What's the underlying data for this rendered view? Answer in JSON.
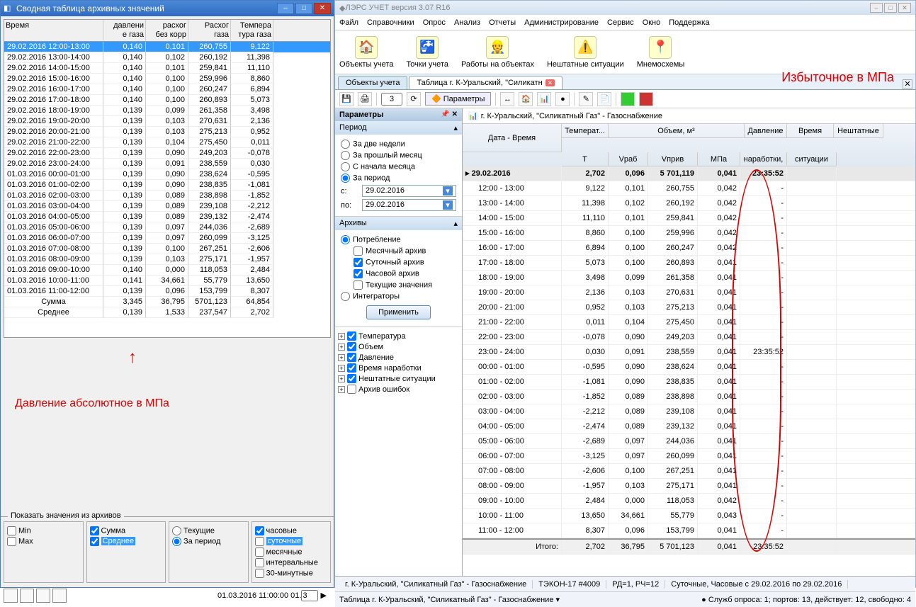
{
  "left": {
    "title": "Сводная таблица архивных значений",
    "headers": [
      "Время",
      "давлени\nе газа",
      "расхог\nбез корр",
      "Расхог\nгаза",
      "Темпера\nтура газа"
    ],
    "rows": [
      [
        "29.02.2016 12:00-13:00",
        "0,140",
        "0,101",
        "260,755",
        "9,122"
      ],
      [
        "29.02.2016 13:00-14:00",
        "0,140",
        "0,102",
        "260,192",
        "11,398"
      ],
      [
        "29.02.2016 14:00-15:00",
        "0,140",
        "0,101",
        "259,841",
        "11,110"
      ],
      [
        "29.02.2016 15:00-16:00",
        "0,140",
        "0,100",
        "259,996",
        "8,860"
      ],
      [
        "29.02.2016 16:00-17:00",
        "0,140",
        "0,100",
        "260,247",
        "6,894"
      ],
      [
        "29.02.2016 17:00-18:00",
        "0,140",
        "0,100",
        "260,893",
        "5,073"
      ],
      [
        "29.02.2016 18:00-19:00",
        "0,139",
        "0,099",
        "261,358",
        "3,498"
      ],
      [
        "29.02.2016 19:00-20:00",
        "0,139",
        "0,103",
        "270,631",
        "2,136"
      ],
      [
        "29.02.2016 20:00-21:00",
        "0,139",
        "0,103",
        "275,213",
        "0,952"
      ],
      [
        "29.02.2016 21:00-22:00",
        "0,139",
        "0,104",
        "275,450",
        "0,011"
      ],
      [
        "29.02.2016 22:00-23:00",
        "0,139",
        "0,090",
        "249,203",
        "-0,078"
      ],
      [
        "29.02.2016 23:00-24:00",
        "0,139",
        "0,091",
        "238,559",
        "0,030"
      ],
      [
        "01.03.2016 00:00-01:00",
        "0,139",
        "0,090",
        "238,624",
        "-0,595"
      ],
      [
        "01.03.2016 01:00-02:00",
        "0,139",
        "0,090",
        "238,835",
        "-1,081"
      ],
      [
        "01.03.2016 02:00-03:00",
        "0,139",
        "0,089",
        "238,898",
        "-1,852"
      ],
      [
        "01.03.2016 03:00-04:00",
        "0,139",
        "0,089",
        "239,108",
        "-2,212"
      ],
      [
        "01.03.2016 04:00-05:00",
        "0,139",
        "0,089",
        "239,132",
        "-2,474"
      ],
      [
        "01.03.2016 05:00-06:00",
        "0,139",
        "0,097",
        "244,036",
        "-2,689"
      ],
      [
        "01.03.2016 06:00-07:00",
        "0,139",
        "0,097",
        "260,099",
        "-3,125"
      ],
      [
        "01.03.2016 07:00-08:00",
        "0,139",
        "0,100",
        "267,251",
        "-2,606"
      ],
      [
        "01.03.2016 08:00-09:00",
        "0,139",
        "0,103",
        "275,171",
        "-1,957"
      ],
      [
        "01.03.2016 09:00-10:00",
        "0,140",
        "0,000",
        "118,053",
        "2,484"
      ],
      [
        "01.03.2016 10:00-11:00",
        "0,141",
        "34,661",
        "55,779",
        "13,650"
      ],
      [
        "01.03.2016 11:00-12:00",
        "0,139",
        "0,096",
        "153,799",
        "8,307"
      ]
    ],
    "sum": [
      "Сумма",
      "3,345",
      "36,795",
      "5701,123",
      "64,854"
    ],
    "avg": [
      "Среднее",
      "0,139",
      "1,533",
      "237,547",
      "2,702"
    ],
    "annot": "Давление абсолютное в МПа",
    "bottom_title": "Показать значения из архивов",
    "opts1": {
      "min": "Min",
      "max": "Max",
      "sum": "Сумма",
      "avg": "Среднее"
    },
    "opts2": {
      "cur": "Текущие",
      "per": "За период"
    },
    "opts3": {
      "h": "часовые",
      "d": "суточные",
      "m": "месячные",
      "i": "интервальные",
      "t": "30-минутные"
    },
    "status": "01.03.2016 11:00:00 01.",
    "status_n": "3"
  },
  "right": {
    "title": "ЛЭРС УЧЕТ версия 3.07 R16",
    "menu": [
      "Файл",
      "Справочники",
      "Опрос",
      "Анализ",
      "Отчеты",
      "Администрирование",
      "Сервис",
      "Окно",
      "Поддержка"
    ],
    "toolbar": [
      "Объекты учета",
      "Точки учета",
      "Работы на объектах",
      "Нештатные ситуации",
      "Мнемосхемы"
    ],
    "tabs": {
      "t1": "Объекты учета",
      "t2": "Таблица г. К-Уральский, \"Силикатн"
    },
    "page_input": "3",
    "params_btn": "Параметры",
    "side": {
      "title": "Параметры",
      "g_period": "Период",
      "p1": "За две недели",
      "p2": "За прошлый месяц",
      "p3": "С начала месяца",
      "p4": "За период",
      "from_lbl": "с:",
      "to_lbl": "по:",
      "date": "29.02.2016",
      "g_arch": "Архивы",
      "a1": "Потребление",
      "a2": "Месячный архив",
      "a3": "Суточный архив",
      "a4": "Часовой архив",
      "a5": "Текущие значения",
      "a6": "Интеграторы",
      "apply": "Применить",
      "tree": [
        "Температура",
        "Объем",
        "Давление",
        "Время наработки",
        "Нештатные ситуации",
        "Архив ошибок"
      ]
    },
    "crumb": "г. К-Уральский, \"Силикатный Газ\" - Газоснабжение",
    "annot": "Избыточное в МПа",
    "headers_top": {
      "dt": "Дата - Время",
      "temp": "Температ...",
      "vol": "Объем, м³",
      "davl": "Давление",
      "vrem": "Время",
      "nesh": "Нештатные"
    },
    "headers_bot": {
      "t": "T",
      "vr": "Vраб",
      "vp": "Vприв",
      "mpa": "МПа",
      "nar": "наработки,",
      "sit": "ситуации"
    },
    "group_date": "29.02.2016",
    "group_vals": [
      "2,702",
      "0,096",
      "5 701,119",
      "0,041",
      "23:35:52"
    ],
    "rows": [
      [
        "12:00 - 13:00",
        "9,122",
        "0,101",
        "260,755",
        "0,042",
        "-",
        ""
      ],
      [
        "13:00 - 14:00",
        "11,398",
        "0,102",
        "260,192",
        "0,042",
        "-",
        ""
      ],
      [
        "14:00 - 15:00",
        "11,110",
        "0,101",
        "259,841",
        "0,042",
        "-",
        ""
      ],
      [
        "15:00 - 16:00",
        "8,860",
        "0,100",
        "259,996",
        "0,042",
        "-",
        ""
      ],
      [
        "16:00 - 17:00",
        "6,894",
        "0,100",
        "260,247",
        "0,042",
        "-",
        ""
      ],
      [
        "17:00 - 18:00",
        "5,073",
        "0,100",
        "260,893",
        "0,041",
        "-",
        ""
      ],
      [
        "18:00 - 19:00",
        "3,498",
        "0,099",
        "261,358",
        "0,041",
        "-",
        ""
      ],
      [
        "19:00 - 20:00",
        "2,136",
        "0,103",
        "270,631",
        "0,041",
        "-",
        ""
      ],
      [
        "20:00 - 21:00",
        "0,952",
        "0,103",
        "275,213",
        "0,041",
        "-",
        ""
      ],
      [
        "21:00 - 22:00",
        "0,011",
        "0,104",
        "275,450",
        "0,041",
        "-",
        ""
      ],
      [
        "22:00 - 23:00",
        "-0,078",
        "0,090",
        "249,203",
        "0,041",
        "-",
        ""
      ],
      [
        "23:00 - 24:00",
        "0,030",
        "0,091",
        "238,559",
        "0,041",
        "23:35:52",
        ""
      ],
      [
        "00:00 - 01:00",
        "-0,595",
        "0,090",
        "238,624",
        "0,041",
        "-",
        ""
      ],
      [
        "01:00 - 02:00",
        "-1,081",
        "0,090",
        "238,835",
        "0,041",
        "-",
        ""
      ],
      [
        "02:00 - 03:00",
        "-1,852",
        "0,089",
        "238,898",
        "0,041",
        "-",
        ""
      ],
      [
        "03:00 - 04:00",
        "-2,212",
        "0,089",
        "239,108",
        "0,041",
        "-",
        ""
      ],
      [
        "04:00 - 05:00",
        "-2,474",
        "0,089",
        "239,132",
        "0,041",
        "-",
        ""
      ],
      [
        "05:00 - 06:00",
        "-2,689",
        "0,097",
        "244,036",
        "0,041",
        "-",
        ""
      ],
      [
        "06:00 - 07:00",
        "-3,125",
        "0,097",
        "260,099",
        "0,041",
        "-",
        ""
      ],
      [
        "07:00 - 08:00",
        "-2,606",
        "0,100",
        "267,251",
        "0,041",
        "-",
        ""
      ],
      [
        "08:00 - 09:00",
        "-1,957",
        "0,103",
        "275,171",
        "0,041",
        "-",
        ""
      ],
      [
        "09:00 - 10:00",
        "2,484",
        "0,000",
        "118,053",
        "0,042",
        "-",
        ""
      ],
      [
        "10:00 - 11:00",
        "13,650",
        "34,661",
        "55,779",
        "0,043",
        "-",
        ""
      ],
      [
        "11:00 - 12:00",
        "8,307",
        "0,096",
        "153,799",
        "0,041",
        "-",
        ""
      ]
    ],
    "total_lbl": "Итого:",
    "total": [
      "2,702",
      "36,795",
      "5 701,123",
      "0,041",
      "23:35:52"
    ],
    "status1": [
      "г. К-Уральский, \"Силикатный Газ\" - Газоснабжение",
      "ТЭКОН-17 #4009",
      "РД=1, РЧ=12",
      "Суточные, Часовые с 29.02.2016 по 29.02.2016"
    ],
    "status2_l": "Таблица г. К-Уральский, \"Силикатный Газ\" - Газоснабжение ▾",
    "status2_r": "Служб опроса: 1; портов: 13, действует: 12, свободно: 4"
  }
}
